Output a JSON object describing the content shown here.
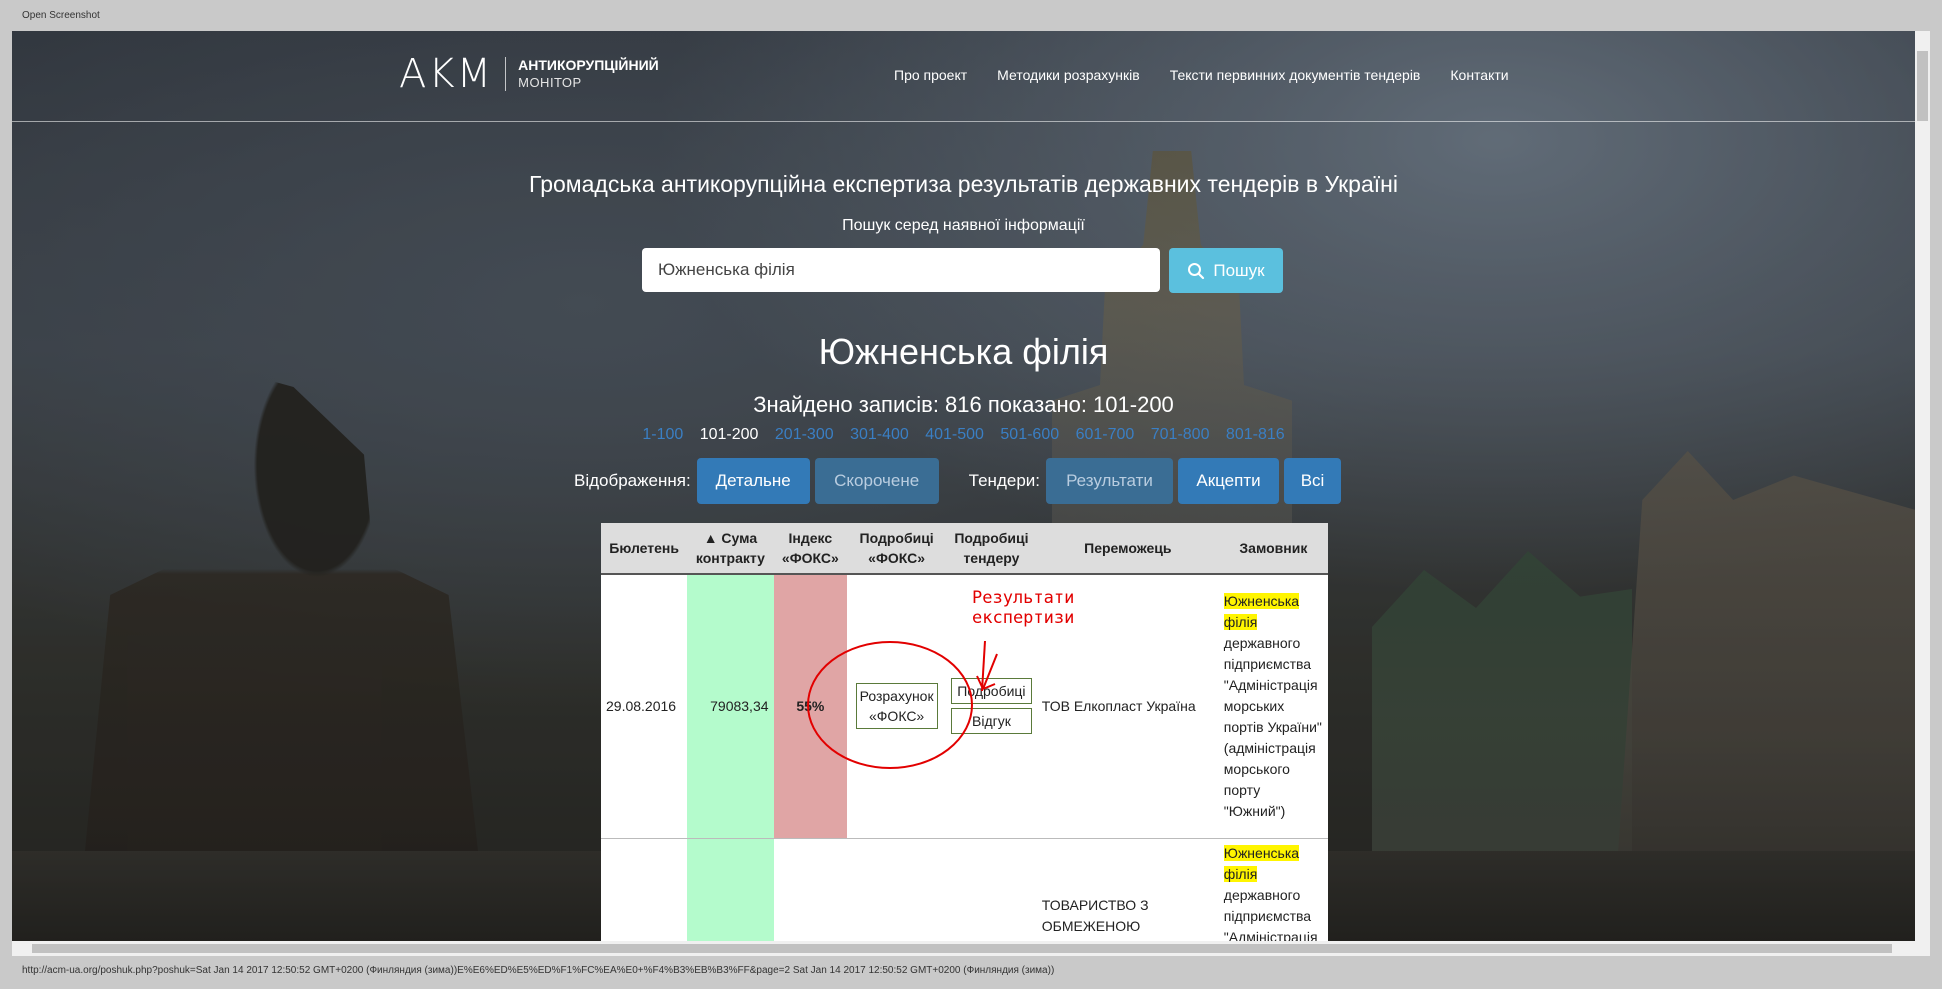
{
  "window": {
    "title": "Open Screenshot"
  },
  "header": {
    "logo_mark": "AKM",
    "logo_line1": "АНТИКОРУПЦІЙНИЙ",
    "logo_line2": "МОНІТОР",
    "nav": [
      "Про проект",
      "Методики розрахунків",
      "Тексти первинних документів тендерів",
      "Контакти"
    ]
  },
  "hero": {
    "title": "Громадська антикорупційна експертиза результатів державних тендерів в Україні",
    "search_label": "Пошук серед наявної інформації",
    "search_value": "Южненська філія",
    "search_button": "Пошук"
  },
  "results": {
    "query_title": "Южненська філія",
    "found_text": "Знайдено записів: 816 показано: 101-200",
    "pages": [
      "1-100",
      "101-200",
      "201-300",
      "301-400",
      "401-500",
      "501-600",
      "601-700",
      "701-800",
      "801-816"
    ],
    "current_page": "101-200"
  },
  "controls": {
    "display_label": "Відображення:",
    "display_detailed": "Детальне",
    "display_short": "Скорочене",
    "tenders_label": "Тендери:",
    "tenders_results": "Результати",
    "tenders_accepts": "Акцепти",
    "tenders_all": "Всі"
  },
  "table": {
    "headers": {
      "bulletin": "Бюлетень",
      "sum": "▲ Сума контракту",
      "fox_index": "Індекс «ФОКС»",
      "fox_details": "Подробиці «ФОКС»",
      "tender_details": "Подробиці тендеру",
      "winner": "Переможець",
      "customer": "Замовник"
    },
    "rows": [
      {
        "bulletin": "29.08.2016",
        "sum": "79083,34",
        "fox_index": "55%",
        "fox_btn": "Розрахунок «ФОКС»",
        "tender_btn1": "Подробиці",
        "tender_btn2": "Відгук",
        "winner": "ТОВ Елкопласт Україна",
        "customer_hl": "Южненська філія",
        "customer_rest": "державного підприємства \"Адміністрація морських портів України\" (адміністрація морського порту \"Южний\")"
      },
      {
        "bulletin": "",
        "sum": "",
        "fox_index": "",
        "winner": "ТОВАРИСТВО З ОБМЕЖЕНОЮ",
        "customer_hl": "Южненська філія",
        "customer_rest": "державного підприємства \"Адміністрація"
      }
    ]
  },
  "annotation": {
    "line1": "Результати",
    "line2": "експертизи",
    "color": "#e20000"
  },
  "status_bar": "http://acm-ua.org/poshuk.php?poshuk=Sat Jan 14 2017 12:50:52 GMT+0200 (Финляндия (зима))E%E6%ED%E5%ED%F1%FC%EA%E0+%F4%B3%EB%B3%FF&page=2 Sat Jan 14 2017 12:50:52 GMT+0200 (Финляндия (зима))"
}
